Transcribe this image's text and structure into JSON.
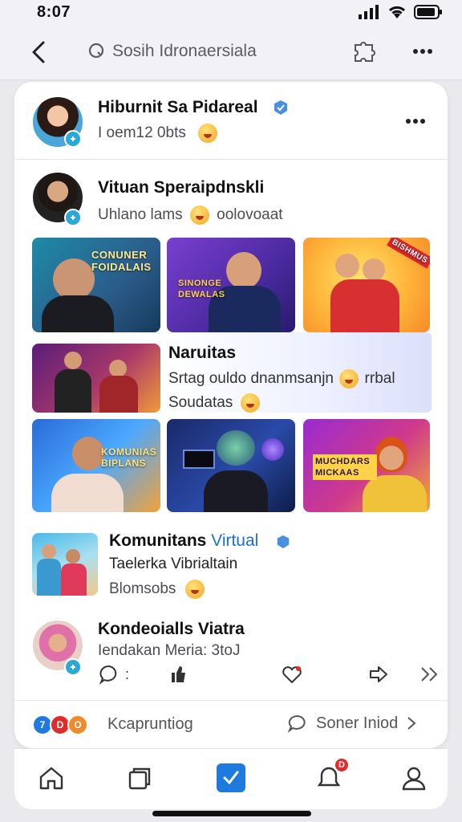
{
  "status": {
    "time": "8:07",
    "icons": [
      "signal-icon",
      "wifi-icon",
      "battery-icon"
    ]
  },
  "nav": {
    "title": "Sosih Idronaersiala",
    "icons": [
      "back-chevron-icon",
      "search-icon",
      "puzzle-icon",
      "more-icon"
    ]
  },
  "posts": [
    {
      "name": "Hiburnit Sa Pidareal",
      "sub": "I oem12 0bts",
      "verified": true
    },
    {
      "name": "Vituan Speraipdnskli",
      "sub": "Uhlano lams",
      "sub_suffix": "oolovoaat"
    }
  ],
  "gallery": {
    "tiles": [
      {
        "label": "CONUNER FOIDALAIS"
      },
      {
        "label": "SINONGE DEWALAS"
      },
      {
        "label": "BISHMUS"
      },
      {
        "label": ""
      },
      {
        "label": "KOMUNIAS BIPLANS"
      },
      {
        "label": ""
      },
      {
        "label": "MUCHDARS MICKAAS"
      }
    ],
    "feature": {
      "title": "Naruitas",
      "line1": "Srtag ouldo dnanmsanjn",
      "line1_suffix": "rrbal",
      "line2": "Soudatas"
    }
  },
  "community": {
    "name_prefix": "Komunitans",
    "name_highlight": "Virtual",
    "line1": "Taelerka Vibrialtain",
    "line2": "Blomsobs"
  },
  "last_post": {
    "name": "Kondeoialls Viatra",
    "sub": "Iendakan Meria: 3toJ"
  },
  "footer": {
    "left_label": "Kcapruntiog",
    "right_label": "Soner Iniod",
    "mini_avatars": [
      "7",
      "D",
      "O"
    ]
  },
  "tabbar": {
    "items": [
      "home-icon",
      "library-icon",
      "check-icon",
      "notifications-icon",
      "profile-icon"
    ],
    "notification_badge": "D",
    "accent": "#1f7ae0"
  },
  "colors": {
    "accent": "#1f7ae0",
    "badge": "#2aa8d6",
    "notify": "#e02b2b"
  }
}
